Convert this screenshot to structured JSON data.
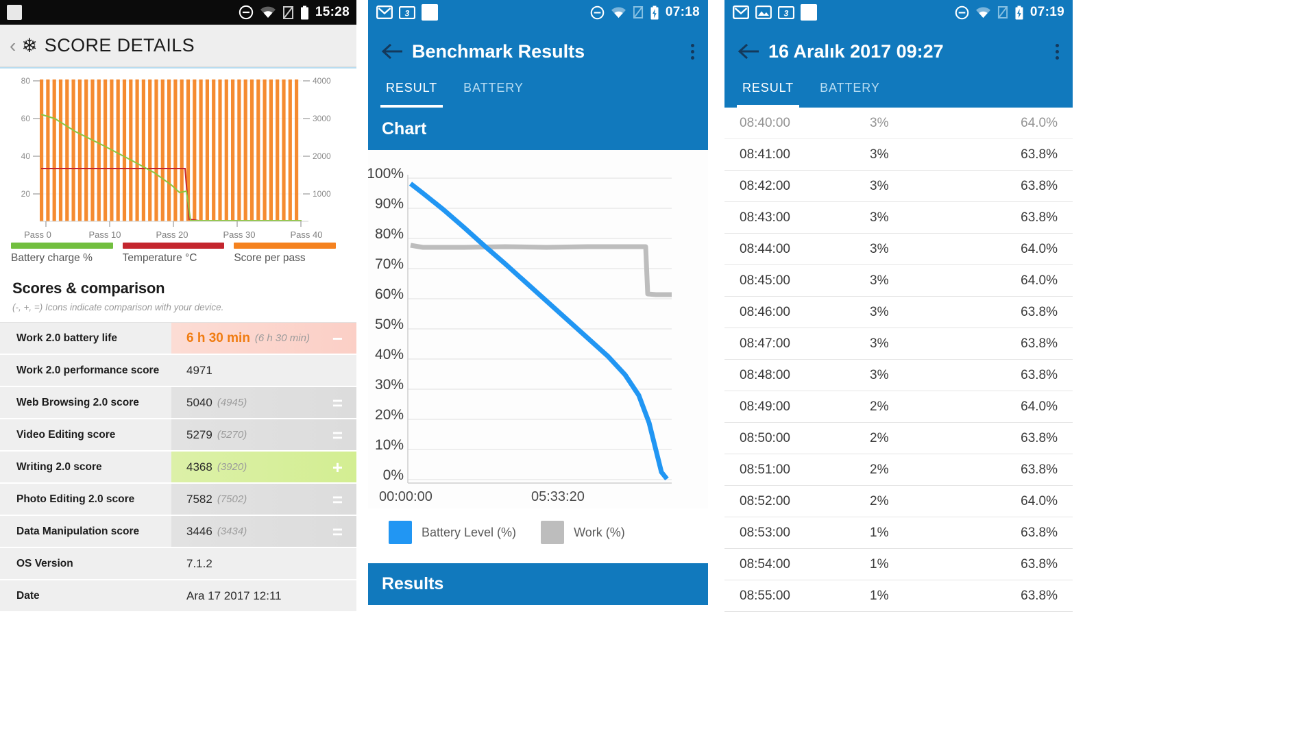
{
  "panel1": {
    "status_bar": {
      "time": "15:28",
      "icons": [
        "app-square-icon",
        "dnd-icon",
        "wifi-icon",
        "signal-off-icon",
        "battery-icon"
      ]
    },
    "app_bar": {
      "back_label": "‹",
      "logo_icon": "snowflake-icon",
      "title": "SCORE DETAILS"
    },
    "legend": [
      {
        "label": "Battery charge %",
        "color": "#72bf3f"
      },
      {
        "label": "Temperature °C",
        "color": "#c4262e"
      },
      {
        "label": "Score per pass",
        "color": "#f5821f"
      }
    ],
    "section": {
      "heading": "Scores & comparison",
      "note": "(-, +, =) Icons indicate comparison with your device."
    },
    "rows": [
      {
        "key": "Work 2.0 battery life",
        "value": "6 h 30 min",
        "compare": "(6 h 30 min)",
        "badge": "−",
        "style": "red"
      },
      {
        "key": "Work 2.0 performance score",
        "value": "4971",
        "compare": "",
        "badge": "",
        "style": "plain"
      },
      {
        "key": "Web Browsing 2.0 score",
        "value": "5040",
        "compare": "(4945)",
        "badge": "=",
        "style": "grey"
      },
      {
        "key": "Video Editing score",
        "value": "5279",
        "compare": "(5270)",
        "badge": "=",
        "style": "grey"
      },
      {
        "key": "Writing 2.0 score",
        "value": "4368",
        "compare": "(3920)",
        "badge": "+",
        "style": "green"
      },
      {
        "key": "Photo Editing 2.0 score",
        "value": "7582",
        "compare": "(7502)",
        "badge": "=",
        "style": "grey"
      },
      {
        "key": "Data Manipulation score",
        "value": "3446",
        "compare": "(3434)",
        "badge": "=",
        "style": "grey"
      },
      {
        "key": "OS Version",
        "value": "7.1.2",
        "compare": "",
        "badge": "",
        "style": "plain"
      },
      {
        "key": "Date",
        "value": "Ara 17 2017 12:11",
        "compare": "",
        "badge": "",
        "style": "plain"
      }
    ]
  },
  "panel2": {
    "status_bar": {
      "time": "07:18",
      "icons": [
        "gmail-icon",
        "3dmark-icon",
        "app-square-icon",
        "dnd-icon",
        "wifi-icon",
        "signal-off-icon",
        "battery-charging-icon"
      ]
    },
    "app_bar": {
      "back_icon": "arrow-back-icon",
      "title": "Benchmark Results",
      "overflow_icon": "kebab-menu-icon"
    },
    "tabs": [
      {
        "label": "RESULT",
        "selected": true
      },
      {
        "label": "BATTERY",
        "selected": false
      }
    ],
    "chart_card_title": "Chart",
    "legend": [
      {
        "label": "Battery Level (%)",
        "color": "#2196f3"
      },
      {
        "label": "Work (%)",
        "color": "#bdbdbd"
      }
    ],
    "footer_card_title": "Results"
  },
  "panel3": {
    "status_bar": {
      "time": "07:19",
      "icons": [
        "gmail-icon",
        "photos-icon",
        "3dmark-icon",
        "app-square-icon",
        "dnd-icon",
        "wifi-icon",
        "signal-off-icon",
        "battery-charging-icon"
      ]
    },
    "app_bar": {
      "back_icon": "arrow-back-icon",
      "title": "16 Aralık 2017 09:27",
      "overflow_icon": "kebab-menu-icon"
    },
    "tabs": [
      {
        "label": "RESULT",
        "selected": true
      },
      {
        "label": "BATTERY",
        "selected": false
      }
    ],
    "rows": [
      {
        "time": "08:40:00",
        "battery": "3%",
        "work": "64.0%",
        "clipped": true
      },
      {
        "time": "08:41:00",
        "battery": "3%",
        "work": "63.8%"
      },
      {
        "time": "08:42:00",
        "battery": "3%",
        "work": "63.8%"
      },
      {
        "time": "08:43:00",
        "battery": "3%",
        "work": "63.8%"
      },
      {
        "time": "08:44:00",
        "battery": "3%",
        "work": "64.0%"
      },
      {
        "time": "08:45:00",
        "battery": "3%",
        "work": "64.0%"
      },
      {
        "time": "08:46:00",
        "battery": "3%",
        "work": "63.8%"
      },
      {
        "time": "08:47:00",
        "battery": "3%",
        "work": "63.8%"
      },
      {
        "time": "08:48:00",
        "battery": "3%",
        "work": "63.8%"
      },
      {
        "time": "08:49:00",
        "battery": "2%",
        "work": "64.0%"
      },
      {
        "time": "08:50:00",
        "battery": "2%",
        "work": "63.8%"
      },
      {
        "time": "08:51:00",
        "battery": "2%",
        "work": "63.8%"
      },
      {
        "time": "08:52:00",
        "battery": "2%",
        "work": "64.0%"
      },
      {
        "time": "08:53:00",
        "battery": "1%",
        "work": "63.8%"
      },
      {
        "time": "08:54:00",
        "battery": "1%",
        "work": "63.8%"
      },
      {
        "time": "08:55:00",
        "battery": "1%",
        "work": "63.8%"
      }
    ]
  },
  "chart_data": [
    {
      "id": "score-details-chart",
      "type": "bar",
      "title": "",
      "xlabel": "",
      "ylabel": "Battery charge % / Temperature °C",
      "y2label": "Score per pass",
      "xticks": [
        "Pass 0",
        "Pass 10",
        "Pass 20",
        "Pass 30",
        "Pass 40"
      ],
      "yticks_left": [
        20,
        40,
        60,
        80
      ],
      "ylim": [
        0,
        85
      ],
      "yticks_right": [
        1000,
        2000,
        3000,
        4000
      ],
      "y2lim": [
        0,
        4250
      ],
      "grid": true,
      "legend_position": "below",
      "series": [
        {
          "name": "Score per pass",
          "type": "bar",
          "color": "#f5821f",
          "axis": "right",
          "values": [
            4100,
            4100,
            4100,
            4100,
            4100,
            4100,
            4100,
            4100,
            4100,
            4100,
            4100,
            4100,
            4100,
            4100,
            4100,
            4100,
            4100,
            4100,
            4100,
            4100,
            4100,
            4100,
            4100,
            4100,
            4100,
            4100,
            4100,
            4100,
            4100,
            4100,
            4100,
            4100,
            4100,
            4100,
            4100,
            4100,
            4100,
            4100,
            4100,
            4100,
            4100
          ]
        },
        {
          "name": "Battery charge %",
          "type": "line",
          "color": "#72bf3f",
          "axis": "left",
          "values": [
            67,
            65,
            63,
            61.5,
            60,
            58,
            56.5,
            55,
            53,
            51.5,
            50,
            48,
            46.5,
            45,
            43,
            41.5,
            40,
            38,
            36.5,
            35,
            33,
            31.5,
            30,
            28,
            27,
            25,
            23,
            22,
            2,
            1,
            1,
            1,
            1,
            1,
            1,
            1,
            1,
            1,
            1,
            1,
            1
          ]
        },
        {
          "name": "Temperature °C",
          "type": "line",
          "color": "#c4262e",
          "axis": "left",
          "values": [
            34,
            34,
            34,
            34,
            34,
            34,
            34,
            34,
            34,
            34,
            34,
            34,
            34,
            34,
            34,
            34,
            34,
            34,
            34,
            34,
            34,
            34,
            34,
            34,
            34,
            34,
            34,
            34,
            1,
            1,
            1,
            1,
            1,
            1,
            1,
            1,
            1,
            1,
            1,
            1,
            1
          ]
        }
      ]
    },
    {
      "id": "benchmark-battery-chart",
      "type": "line",
      "title": "Chart",
      "xlabel": "",
      "ylabel": "",
      "xticks": [
        "00:00:00",
        "05:33:20"
      ],
      "yticks": [
        "0%",
        "10%",
        "20%",
        "30%",
        "40%",
        "50%",
        "60%",
        "70%",
        "80%",
        "90%",
        "100%"
      ],
      "ylim": [
        0,
        100
      ],
      "grid": true,
      "legend_position": "bottom-left",
      "series": [
        {
          "name": "Battery Level (%)",
          "color": "#2196f3",
          "x": [
            0,
            0.04,
            0.1,
            0.2,
            0.3,
            0.4,
            0.5,
            0.6,
            0.7,
            0.8,
            0.9,
            0.97,
            1.0
          ],
          "values": [
            97,
            95,
            89,
            80,
            71,
            62,
            53,
            44,
            35,
            26,
            16,
            6,
            1
          ]
        },
        {
          "name": "Work (%)",
          "color": "#bdbdbd",
          "x": [
            0,
            0.1,
            0.2,
            0.3,
            0.4,
            0.5,
            0.6,
            0.7,
            0.8,
            0.88,
            0.885,
            0.95,
            1.0
          ],
          "values": [
            77.5,
            77,
            77,
            77,
            77,
            77,
            77,
            77,
            77,
            77,
            62,
            61.5,
            61.5
          ]
        }
      ]
    }
  ]
}
